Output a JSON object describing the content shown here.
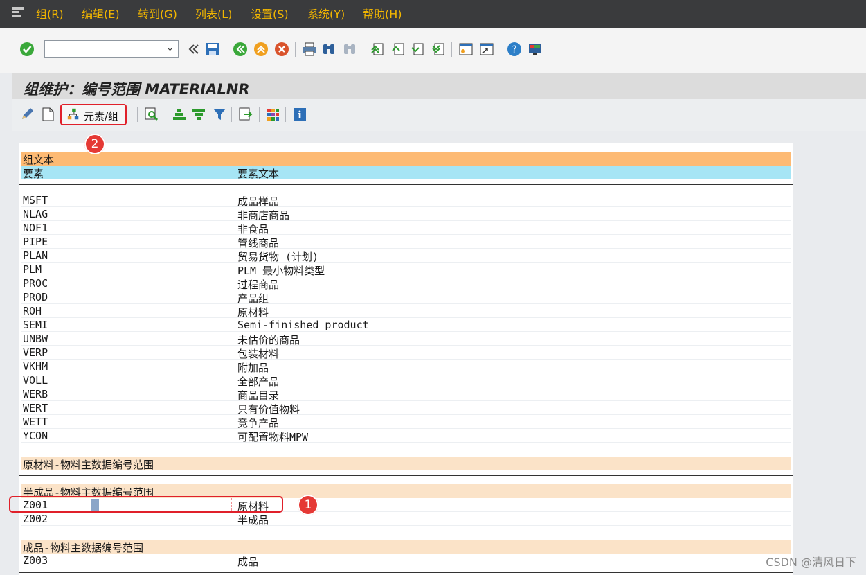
{
  "menubar": {
    "items": [
      "组(R)",
      "编辑(E)",
      "转到(G)",
      "列表(L)",
      "设置(S)",
      "系统(Y)",
      "帮助(H)"
    ]
  },
  "toolbar": {
    "command_field_value": "",
    "icons": [
      "enter-icon",
      "back-double-icon",
      "save-icon",
      "back-icon",
      "exit-icon",
      "cancel-icon",
      "print-icon",
      "find-icon",
      "find-next-icon",
      "first-page-icon",
      "previous-page-icon",
      "next-page-icon",
      "last-page-icon",
      "new-session-icon",
      "shortcut-icon",
      "help-icon",
      "layout-icon"
    ]
  },
  "title": "组维护：编号范围 MATERIALNR",
  "app_toolbar": {
    "element_group_label": "元素/组"
  },
  "list": {
    "header_group_text": "组文本",
    "header_col1": "要素",
    "header_col2": "要素文本",
    "unassigned": [
      {
        "code": "MSFT",
        "text": "成品样品"
      },
      {
        "code": "NLAG",
        "text": "非商店商品"
      },
      {
        "code": "NOF1",
        "text": "非食品"
      },
      {
        "code": "PIPE",
        "text": "管线商品"
      },
      {
        "code": "PLAN",
        "text": "贸易货物 (计划)"
      },
      {
        "code": "PLM",
        "text": "PLM 最小物料类型"
      },
      {
        "code": "PROC",
        "text": "过程商品"
      },
      {
        "code": "PROD",
        "text": "产品组"
      },
      {
        "code": "ROH",
        "text": "原材料"
      },
      {
        "code": "SEMI",
        "text": "Semi-finished product"
      },
      {
        "code": "UNBW",
        "text": "未估价的商品"
      },
      {
        "code": "VERP",
        "text": "包装材料"
      },
      {
        "code": "VKHM",
        "text": "附加品"
      },
      {
        "code": "VOLL",
        "text": "全部产品"
      },
      {
        "code": "WERB",
        "text": "商品目录"
      },
      {
        "code": "WERT",
        "text": "只有价值物料"
      },
      {
        "code": "WETT",
        "text": "竞争产品"
      },
      {
        "code": "YCON",
        "text": "可配置物料MPW"
      }
    ],
    "groups": [
      {
        "title": "原材料-物料主数据编号范围",
        "items": []
      },
      {
        "title": "半成品-物料主数据编号范围",
        "items": [
          {
            "code": "Z001",
            "text": "原材料"
          },
          {
            "code": "Z002",
            "text": "半成品"
          }
        ]
      },
      {
        "title": "成品-物料主数据编号范围",
        "items": [
          {
            "code": "Z003",
            "text": "成品"
          }
        ]
      }
    ]
  },
  "annotations": {
    "callout_1": "1",
    "callout_2": "2"
  },
  "watermark": "CSDN @清风日下",
  "colors": {
    "menubar_bg": "#3a3b3d",
    "menu_text": "#f2b600",
    "group_header": "#fdba74",
    "column_header": "#a6e5f5",
    "group_title": "#fbe3c8",
    "highlight": "#e0202a"
  }
}
